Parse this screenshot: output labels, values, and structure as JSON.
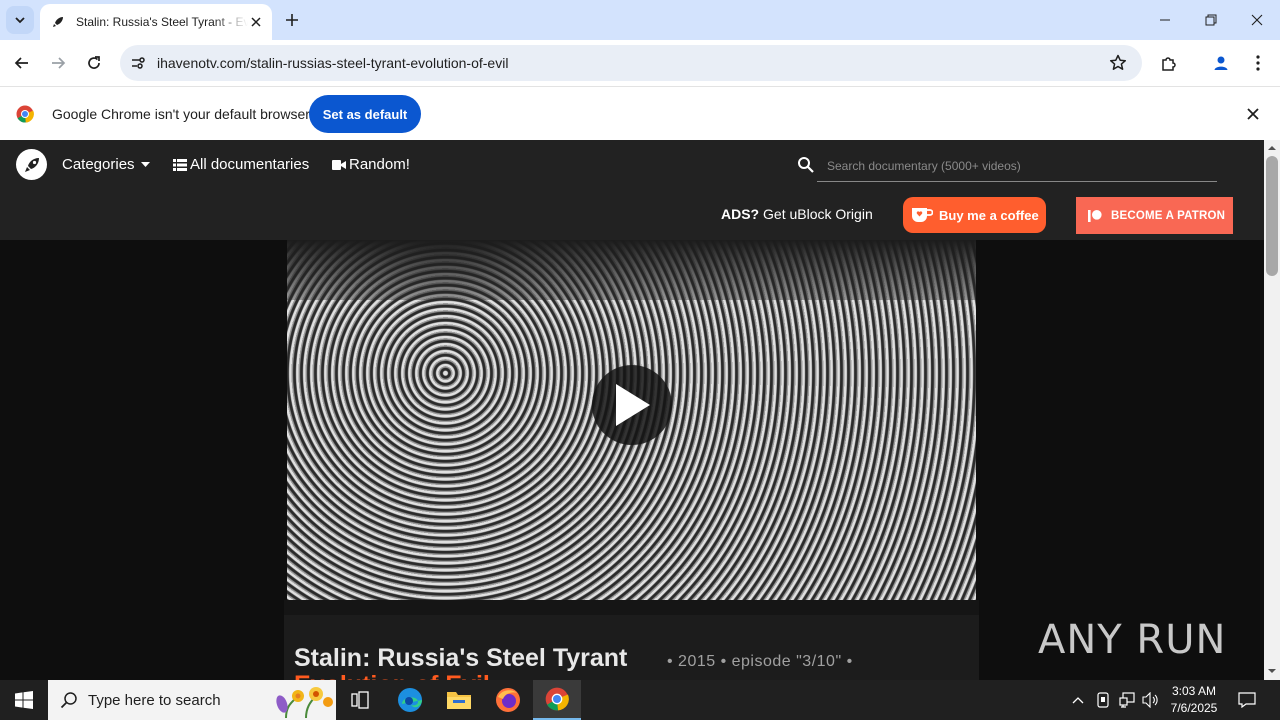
{
  "browser": {
    "tab_title": "Stalin: Russia's Steel Tyrant - Evolution of Evil",
    "url": "ihavenotv.com/stalin-russias-steel-tyrant-evolution-of-evil"
  },
  "infobar": {
    "message": "Google Chrome isn't your default browser",
    "button_label": "Set as default"
  },
  "site": {
    "nav": {
      "categories": "Categories",
      "all_docs": "All documentaries",
      "random": "Random!"
    },
    "search_placeholder": "Search documentary (5000+ videos)",
    "ads_bold": "ADS?",
    "ads_text": " Get uBlock Origin",
    "coffee_label": "Buy me a coffee",
    "patron_label": "BECOME A PATRON"
  },
  "documentary": {
    "title": "Stalin: Russia's Steel Tyrant",
    "meta": "• 2015  • episode \"3/10\" •",
    "subtitle": "Evolution of Evil"
  },
  "watermark": "ANY RUN",
  "taskbar": {
    "search_placeholder": "Type here to search",
    "time": "3:03 AM",
    "date": "7/6/2025"
  },
  "colors": {
    "chrome_blue": "#0b57d0",
    "coffee": "#ff5e2e",
    "patreon": "#f96854",
    "subtitle_orange": "#ff5a1f"
  }
}
